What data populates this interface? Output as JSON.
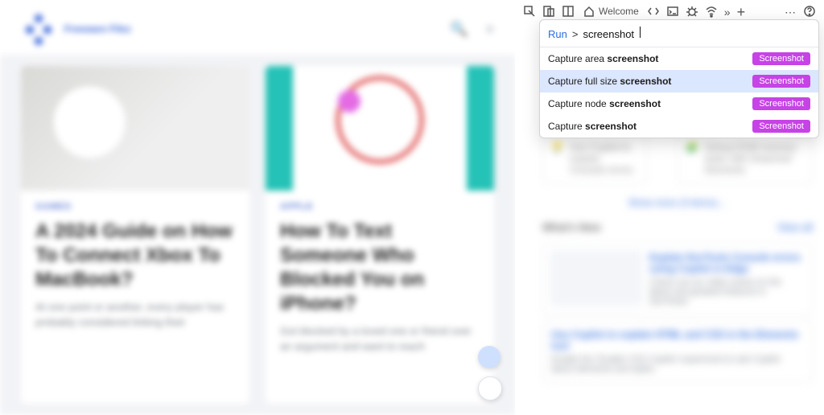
{
  "page": {
    "logo_text": "Freeware Filez",
    "cards": [
      {
        "kicker": "GAMES",
        "title": "A 2024 Guide on How To Connect Xbox To MacBook?",
        "excerpt": "At one point or another, every player has probably considered linking their"
      },
      {
        "kicker": "APPLE",
        "title": "How To Text Someone Who Blocked You on iPhone?",
        "excerpt": "Got blocked by a loved one or friend over an argument and want to reach"
      }
    ]
  },
  "devtools": {
    "welcome_label": "Welcome",
    "hints": [
      "Use Copilot to explain Console errors",
      "Debug DOM memory leaks with Detached Elements"
    ],
    "show_more": "Show more (3 items)…",
    "whats_new": "What's New",
    "view_all": "View all",
    "tile1_title": "Explain DevTools Console errors using Copilot in Edge",
    "tile1_body": "Check out our video series on the latest and greatest features in DevTools!",
    "tile2_title": "Use Copilot to explain HTML and CSS in the Elements tool",
    "tile2_body": "Enable the 'Enable CSS Copilot' experiment to ask Copilot about elements and styles."
  },
  "palette": {
    "prompt": "Run",
    "caret": ">",
    "query": "screenshot",
    "badge": "Screenshot",
    "options": [
      {
        "pre": "Capture area ",
        "match": "screenshot",
        "active": false
      },
      {
        "pre": "Capture full size ",
        "match": "screenshot",
        "active": true
      },
      {
        "pre": "Capture node ",
        "match": "screenshot",
        "active": false
      },
      {
        "pre": "Capture ",
        "match": "screenshot",
        "active": false
      }
    ]
  }
}
